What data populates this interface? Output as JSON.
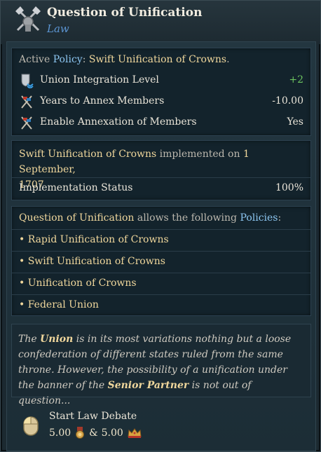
{
  "header": {
    "title": "Question of Unification",
    "subtitle": "Law",
    "icon": "crossed-axes-icon"
  },
  "active_policy": {
    "prefix": "Active",
    "policy_word": "Policy",
    "colon": ": ",
    "name": "Swift Unification of Crowns",
    "suffix": "."
  },
  "modifiers": [
    {
      "icon": "union-shield-icon",
      "label": "Union Integration Level",
      "value": "+2",
      "value_color": "green"
    },
    {
      "icon": "annex-icon",
      "label": "Years to Annex Members",
      "value": "-10.00",
      "value_color": "neutral"
    },
    {
      "icon": "annex-icon",
      "label": "Enable Annexation of Members",
      "value": "Yes",
      "value_color": "neutral"
    }
  ],
  "implementation": {
    "policy_name": "Swift Unification of Crowns",
    "implemented_text": "implemented on",
    "date": "1 September,",
    "year": "1707",
    "status_label": "Implementation Status",
    "status_value": "100%"
  },
  "allowed": {
    "law_name": "Question of Unification",
    "text": "allows the following",
    "policies_word": "Policies",
    "colon": ":",
    "items": [
      "• Rapid Unification of Crowns",
      "• Swift Unification of Crowns",
      "• Unification of Crowns",
      "• Federal Union"
    ]
  },
  "description": {
    "part1": "The ",
    "union": "Union",
    "part2": " is in its most variations nothing but a loose confederation of different states ruled from the same throne. However, the possibility of a unification under the banner of the ",
    "senior_partner": "Senior Partner",
    "part3": " is not out of question..."
  },
  "footer": {
    "action_label": "Start Law Debate",
    "cost_1": "5.00",
    "cost_1_icon": "medal-icon",
    "ampersand": "&",
    "cost_2": "5.00",
    "cost_2_icon": "crown-icon",
    "mouse_icon": "mouse-left-click-icon"
  },
  "colors": {
    "gold": "#f0d79c",
    "blue": "#8cc5f0",
    "green": "#6dc560",
    "subtitle_blue": "#5b94d1"
  }
}
